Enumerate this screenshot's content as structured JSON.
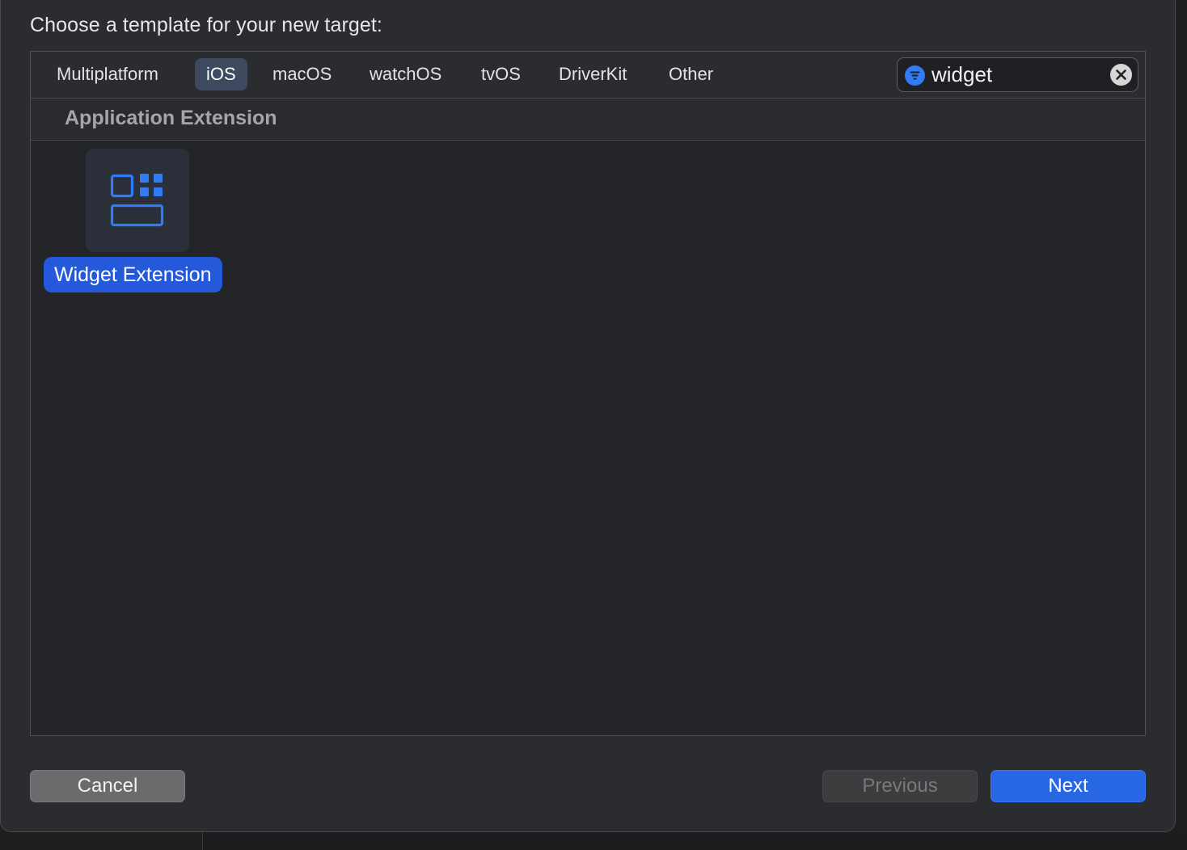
{
  "dialog": {
    "prompt": "Choose a template for your new target:"
  },
  "platform_tabs": [
    {
      "label": "Multiplatform",
      "selected": false
    },
    {
      "label": "iOS",
      "selected": true
    },
    {
      "label": "macOS",
      "selected": false
    },
    {
      "label": "watchOS",
      "selected": false
    },
    {
      "label": "tvOS",
      "selected": false
    },
    {
      "label": "DriverKit",
      "selected": false
    },
    {
      "label": "Other",
      "selected": false
    }
  ],
  "search": {
    "value": "widget",
    "filter_icon": "filter-icon",
    "clear_icon": "clear-icon"
  },
  "section": {
    "title": "Application Extension"
  },
  "templates": [
    {
      "label": "Widget Extension",
      "icon": "widget-icon",
      "selected": true
    }
  ],
  "buttons": {
    "cancel": "Cancel",
    "previous": "Previous",
    "next": "Next"
  },
  "colors": {
    "accent": "#2459d9",
    "selected_tab": "#3d4a60",
    "icon_blue": "#2f7cf6"
  }
}
